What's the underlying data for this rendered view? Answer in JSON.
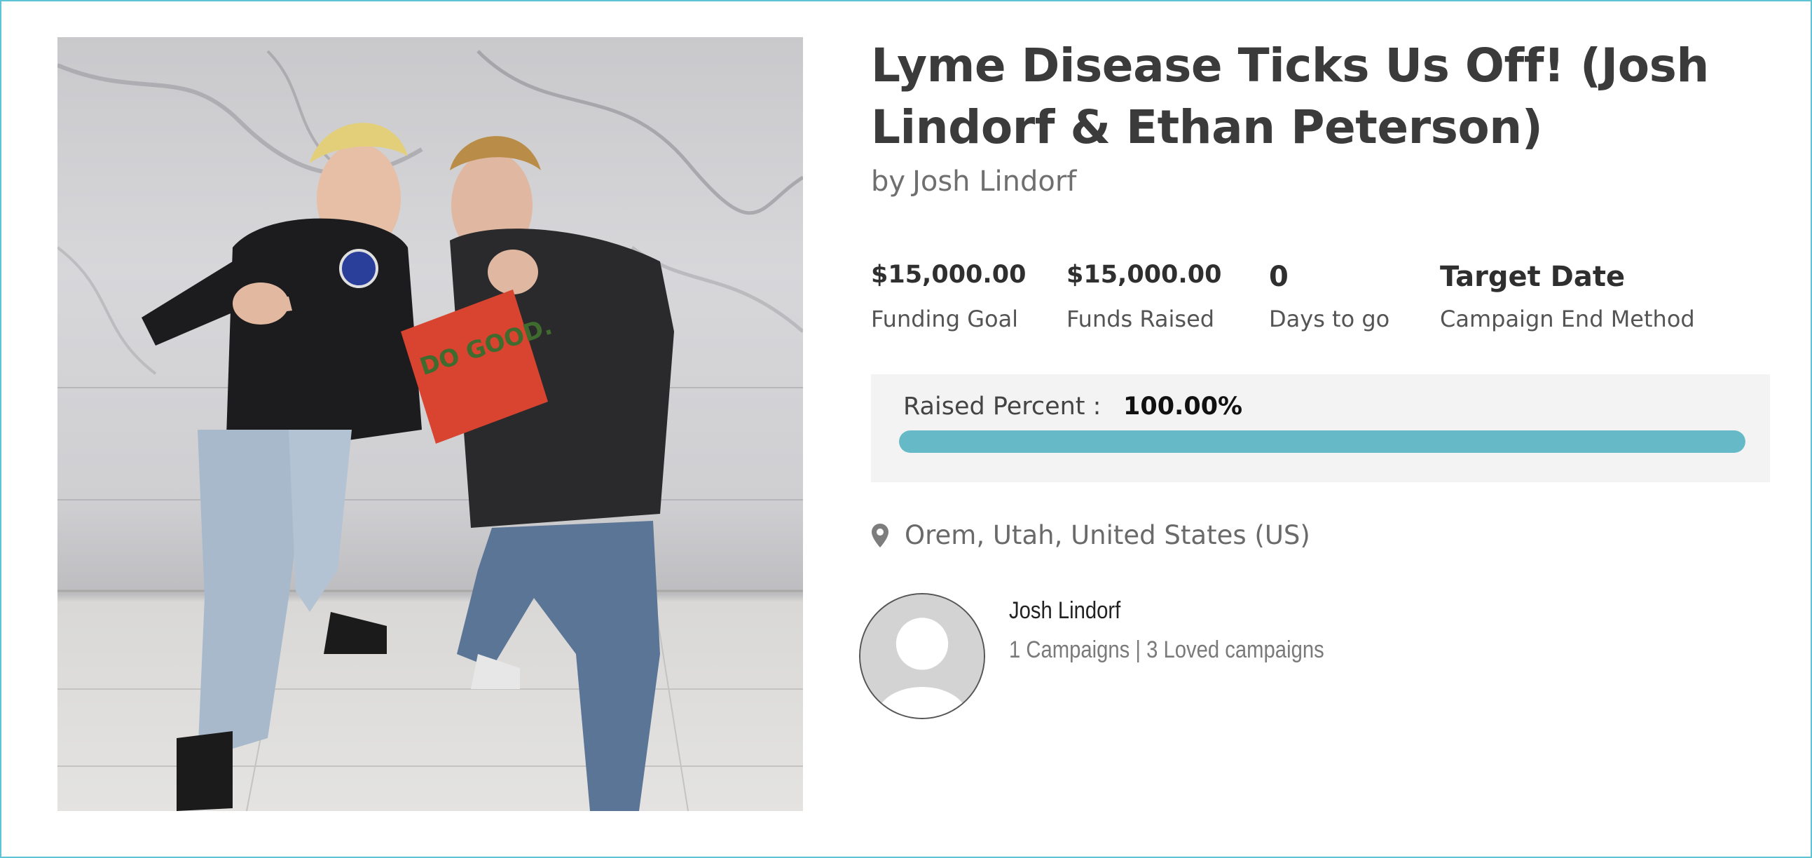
{
  "campaign": {
    "title": "Lyme Disease Ticks Us Off! (Josh Lindorf & Ethan Peterson)",
    "by_prefix": "by",
    "author": "Josh Lindorf",
    "photo_flag_text": "DO GOOD."
  },
  "stats": {
    "funding_goal": {
      "value": "$15,000.00",
      "label": "Funding Goal"
    },
    "funds_raised": {
      "value": "$15,000.00",
      "label": "Funds Raised"
    },
    "days_to_go": {
      "value": "0",
      "label": "Days to go"
    },
    "end_method": {
      "value": "Target Date",
      "label": "Campaign End Method"
    }
  },
  "progress": {
    "label": "Raised Percent :",
    "value_text": "100.00%",
    "percent": 100,
    "color": "#66b9c7"
  },
  "location": {
    "icon": "map-pin-icon",
    "text": "Orem, Utah, United States (US)"
  },
  "owner": {
    "name": "Josh Lindorf",
    "stats_text": "1 Campaigns | 3 Loved campaigns"
  },
  "colors": {
    "frame_border": "#5fc3d6",
    "stats_box_bg": "#f3f3f3",
    "title": "#3b3b3b"
  }
}
